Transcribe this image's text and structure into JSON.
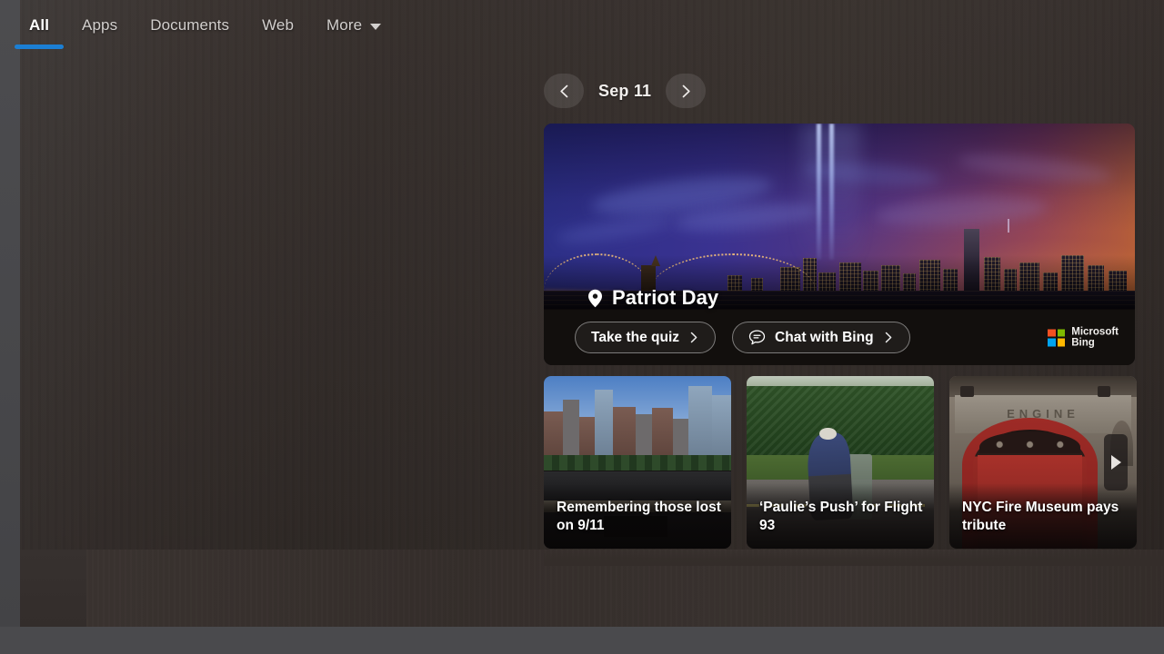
{
  "tabs": [
    {
      "label": "All",
      "active": true
    },
    {
      "label": "Apps",
      "active": false
    },
    {
      "label": "Documents",
      "active": false
    },
    {
      "label": "Web",
      "active": false
    },
    {
      "label": "More",
      "active": false,
      "has_caret": true
    }
  ],
  "accent_color": "#1b7fd4",
  "date_nav": {
    "prev_icon": "chevron-left-icon",
    "next_icon": "chevron-right-icon",
    "label": "Sep 11"
  },
  "hero": {
    "pin_icon": "location-pin-icon",
    "title": "Patriot Day",
    "actions": [
      {
        "label": "Take the quiz",
        "icon": null,
        "chevron": "chevron-right-icon"
      },
      {
        "label": "Chat with Bing",
        "icon": "chat-bubble-icon",
        "chevron": "chevron-right-icon"
      }
    ],
    "brand": {
      "line1": "Microsoft",
      "line2": "Bing",
      "square_colors": [
        "#f25022",
        "#7fba00",
        "#00a4ef",
        "#ffb900"
      ]
    }
  },
  "thumbnails": [
    {
      "title": "Remembering those lost on 9/11",
      "scene": "nine-eleven-memorial-pool"
    },
    {
      "title": "‘Paulie’s Push’ for Flight 93",
      "scene": "person-pushing-on-road"
    },
    {
      "title": "NYC Fire Museum pays tribute",
      "scene": "fire-museum-red-arch"
    }
  ],
  "carousel": {
    "next_icon": "play-right-arrow-icon"
  },
  "thumb3_sign_text": "ENGINE"
}
